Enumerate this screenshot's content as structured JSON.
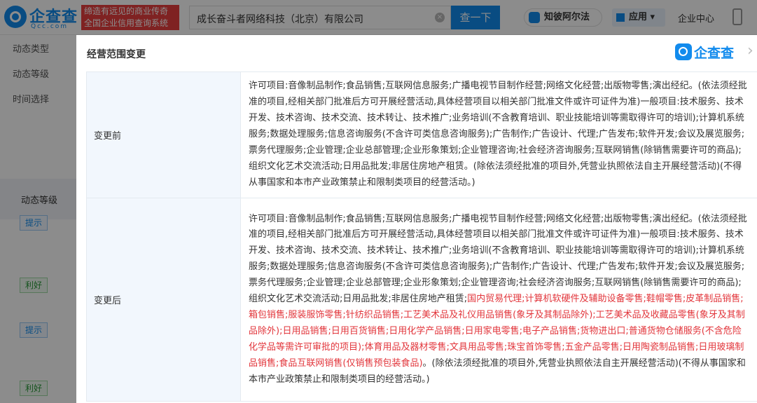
{
  "header": {
    "logo_text": "企查查",
    "logo_sub": "Qcc.com",
    "slogan_line1": "缔造有远见的商业传奇",
    "slogan_line2": "全国企业信用查询系统",
    "search_value": "成长奋斗者网络科技（北京）有限公司",
    "search_button": "查一下",
    "zhibi_label": "知彼阿尔法",
    "app_label": "应用",
    "enterprise_center": "企业中心"
  },
  "left_panel": {
    "items": [
      "动态类型",
      "动态等级",
      "时间选择"
    ],
    "block_label": "动态等级",
    "tags": [
      "提示",
      "利好",
      "提示",
      "利好"
    ]
  },
  "modal": {
    "title": "经营范围变更",
    "logo_text": "企查查",
    "close_glyph": "›",
    "rows": [
      {
        "label": "变更前",
        "text": "许可项目:音像制品制作;食品销售;互联网信息服务;广播电视节目制作经营;网络文化经营;出版物零售;演出经纪。(依法须经批准的项目,经相关部门批准后方可开展经营活动,具体经营项目以相关部门批准文件或许可证件为准)一般项目:技术服务、技术开发、技术咨询、技术交流、技术转让、技术推广;业务培训(不含教育培训、职业技能培训等需取得许可的培训);计算机系统服务;数据处理服务;信息咨询服务(不含许可类信息咨询服务);广告制作;广告设计、代理;广告发布;软件开发;会议及展览服务;票务代理服务;企业管理;企业总部管理;企业形象策划;企业管理咨询;社会经济咨询服务;互联网销售(除销售需要许可的商品);组织文化艺术交流活动;日用品批发;非居住房地产租赁。(除依法须经批准的项目外,凭营业执照依法自主开展经营活动)(不得从事国家和本市产业政策禁止和限制类项目的经营活动。)"
      },
      {
        "label": "变更后",
        "text_before": "许可项目:音像制品制作;食品销售;互联网信息服务;广播电视节目制作经营;网络文化经营;出版物零售;演出经纪。(依法须经批准的项目,经相关部门批准后方可开展经营活动,具体经营项目以相关部门批准文件或许可证件为准)一般项目:技术服务、技术开发、技术咨询、技术交流、技术转让、技术推广;业务培训(不含教育培训、职业技能培训等需取得许可的培训);计算机系统服务;数据处理服务;信息咨询服务(不含许可类信息咨询服务);广告制作;广告设计、代理;广告发布;软件开发;会议及展览服务;票务代理服务;企业管理;企业总部管理;企业形象策划;企业管理咨询;社会经济咨询服务;互联网销售(除销售需要许可的商品);组织文化艺术交流活动;日用品批发;非居住房地产租赁;",
        "text_highlight": "国内贸易代理;计算机软硬件及辅助设备零售;鞋帽零售;皮革制品销售;箱包销售;服装服饰零售;针纺织品销售;工艺美术品及礼仪用品销售(象牙及其制品除外);工艺美术品及收藏品零售(象牙及其制品除外);日用品销售;日用百货销售;日用化学产品销售;日用家电零售;电子产品销售;货物进出口;普通货物仓储服务(不含危险化学品等需许可审批的项目);体育用品及器材零售;文具用品零售;珠宝首饰零售;五金产品零售;日用陶瓷制品销售;日用玻璃制品销售;食品互联网销售(仅销售预包装食品)",
        "text_after": "。(除依法须经批准的项目外,凭营业执照依法自主开展经营活动)(不得从事国家和本市产业政策禁止和限制类项目的经营活动。)"
      }
    ]
  },
  "colors": {
    "brand": "#128bed",
    "highlight": "#e2353b",
    "label_bg": "#f2f7fd",
    "slogan_bg": "#e73f3f"
  },
  "icons": [
    "logo-icon",
    "clear-icon",
    "zhibi-icon",
    "app-grid-icon",
    "phone-icon",
    "close-icon"
  ]
}
